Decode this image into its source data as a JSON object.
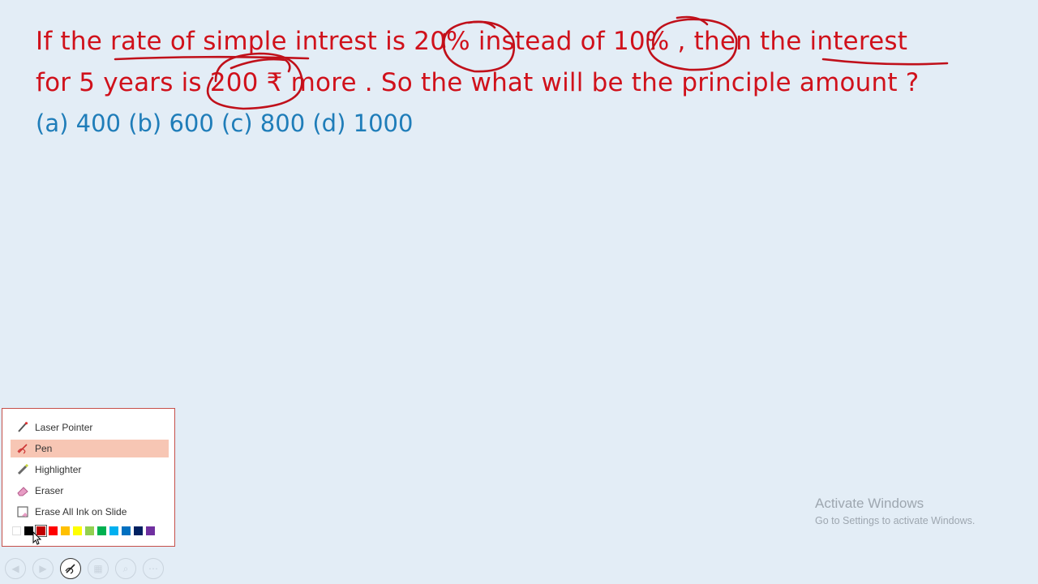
{
  "slide": {
    "question_line1": "If the rate of simple intrest is 20% instead of 10% , then the interest",
    "question_line2": "for 5 years is 200 ₹  more . So the what will be the principle amount ?",
    "options_line": "(a) 400 (b) 600 (c) 800 (d) 1000"
  },
  "pen_menu": {
    "items": [
      {
        "label": "Laser Pointer",
        "icon": "laser-pointer-icon",
        "selected": false
      },
      {
        "label": "Pen",
        "icon": "pen-icon",
        "selected": true
      },
      {
        "label": "Highlighter",
        "icon": "highlighter-icon",
        "selected": false
      },
      {
        "label": "Eraser",
        "icon": "eraser-icon",
        "selected": false
      },
      {
        "label": "Erase All Ink on Slide",
        "icon": "erase-all-ink-icon",
        "selected": false
      }
    ],
    "colors": [
      "#ffffff",
      "#000000",
      "#c00000",
      "#ff0000",
      "#ffc000",
      "#ffff00",
      "#92d050",
      "#00b050",
      "#00b0f0",
      "#0070c0",
      "#002060",
      "#7030a0"
    ],
    "selected_color": "#c00000"
  },
  "toolbar": {
    "buttons": [
      "previous-icon",
      "next-icon",
      "pen-tools-icon",
      "see-all-slides-icon",
      "zoom-icon",
      "more-options-icon"
    ]
  },
  "watermark": {
    "title": "Activate Windows",
    "subtitle": "Go to Settings to activate Windows."
  },
  "colors": {
    "background": "#e3edf6",
    "question_text": "#d0111b",
    "options_text": "#1f7db9",
    "ink": "#c0101a",
    "menu_selected": "#f7c6b4"
  }
}
